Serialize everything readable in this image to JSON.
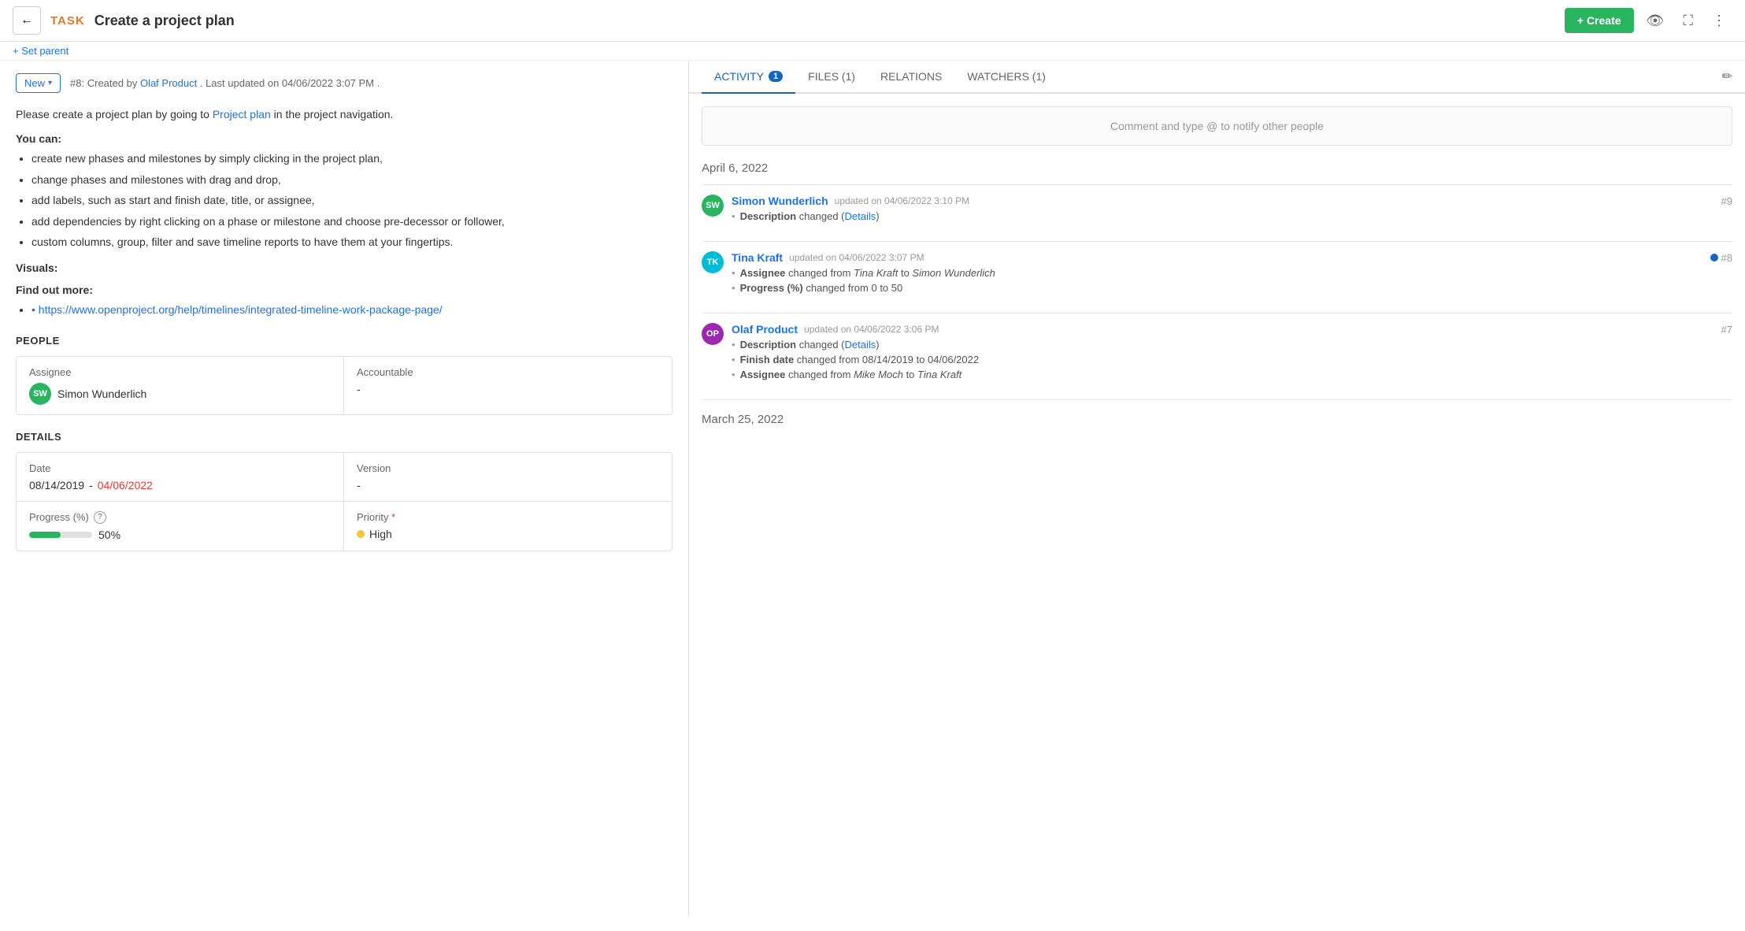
{
  "setParent": "+ Set parent",
  "backBtn": "←",
  "taskLabel": "TASK",
  "taskTitle": "Create a project plan",
  "createBtn": "+ Create",
  "topIcons": {
    "eye": "👁",
    "expand": "⛶",
    "more": "⋮"
  },
  "status": {
    "badge": "New",
    "meta": "#8: Created by",
    "createdBy": "Olaf Product",
    "updatedText": ". Last updated on 04/06/2022 3:07 PM ."
  },
  "description": {
    "prefix": "Please create a project plan by going to",
    "linkText": "Project plan",
    "suffix": "in the project navigation.",
    "youCan": "You can:",
    "bullets": [
      "create new phases and milestones by simply clicking in the project plan,",
      "change phases and milestones with drag and drop,",
      "add labels, such as start and finish date, title, or assignee,",
      "add dependencies by right clicking on a phase or milestone and choose pre-decessor or follower,",
      "custom columns, group, filter and save timeline reports to have them at your fingertips."
    ],
    "visuals": "Visuals:",
    "findOut": "Find out more:",
    "findLink": "https://www.openproject.org/help/timelines/integrated-timeline-work-package-page/"
  },
  "people": {
    "sectionTitle": "PEOPLE",
    "assigneeLabel": "Assignee",
    "assigneeName": "Simon Wunderlich",
    "assigneeInitials": "SW",
    "accountableLabel": "Accountable",
    "accountableValue": "-"
  },
  "details": {
    "sectionTitle": "DETAILS",
    "dateLabel": "Date",
    "dateStart": "08/14/2019",
    "dateSep": " - ",
    "dateEnd": "04/06/2022",
    "progressLabel": "Progress (%)",
    "progressValue": "50%",
    "progressPercent": 50,
    "versionLabel": "Version",
    "versionValue": "-",
    "priorityLabel": "Priority",
    "priorityRequired": "*",
    "priorityValue": "High"
  },
  "rightPanel": {
    "tabs": [
      {
        "label": "ACTIVITY",
        "badge": "1",
        "active": true
      },
      {
        "label": "FILES (1)",
        "badge": null,
        "active": false
      },
      {
        "label": "RELATIONS",
        "badge": null,
        "active": false
      },
      {
        "label": "WATCHERS (1)",
        "badge": null,
        "active": false
      }
    ],
    "commentPlaceholder": "Comment and type @ to notify other people",
    "dateDivider1": "April 6, 2022",
    "activities": [
      {
        "initials": "SW",
        "avatarColor": "#29b560",
        "name": "Simon Wunderlich",
        "time": "updated on 04/06/2022 3:10 PM",
        "id": "#9",
        "dotBlue": false,
        "changes": [
          {
            "field": "Description",
            "text": "changed (",
            "link": "Details",
            "after": ")"
          }
        ]
      },
      {
        "initials": "TK",
        "avatarColor": "#00bcd4",
        "name": "Tina Kraft",
        "time": "updated on 04/06/2022 3:07 PM",
        "id": "#8",
        "dotBlue": true,
        "changes": [
          {
            "field": "Assignee",
            "text": "changed from ",
            "italic1": "Tina Kraft",
            "to": " to ",
            "italic2": "Simon Wunderlich",
            "link": null
          },
          {
            "field": "Progress (%)",
            "text": "changed from 0 to 50",
            "link": null
          }
        ]
      },
      {
        "initials": "OP",
        "avatarColor": "#9c27b0",
        "name": "Olaf Product",
        "time": "updated on 04/06/2022 3:06 PM",
        "id": "#7",
        "dotBlue": false,
        "changes": [
          {
            "field": "Description",
            "text": "changed (",
            "link": "Details",
            "after": ")"
          },
          {
            "field": "Finish date",
            "text": "changed from 08/14/2019 to 04/06/2022",
            "link": null
          },
          {
            "field": "Assignee",
            "text": "changed from ",
            "italic1": "Mike Moch",
            "to": " to ",
            "italic2": "Tina Kraft",
            "link": null
          }
        ]
      }
    ],
    "dateDivider2": "March 25, 2022"
  }
}
